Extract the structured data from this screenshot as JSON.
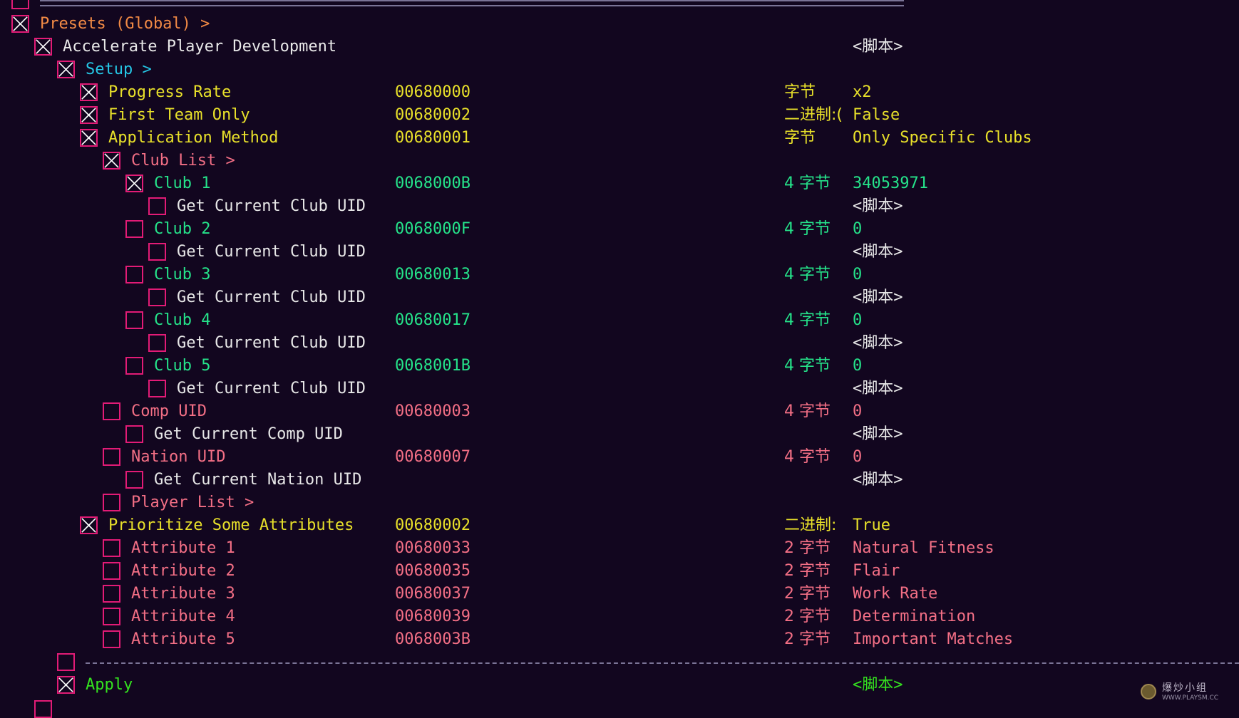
{
  "colors": {
    "background": "#12061f",
    "checkbox_border": "#e21b76",
    "checkbox_cross": "#ffffff",
    "orange": "#f28a45",
    "white": "#e8e8e8",
    "cyan": "#25c8e6",
    "yellow": "#e8e02a",
    "pink": "#f36f85",
    "green": "#25e38a",
    "apply_green": "#34e21f",
    "separator": "#7a7396"
  },
  "watermark": {
    "title": "爆炒小组",
    "url": "WWW.PLAYSM.CC"
  },
  "rows": [
    {
      "id": "presets-global",
      "level": 0,
      "checked": true,
      "color": "orange",
      "label": "Presets (Global) >",
      "address": "",
      "type": "",
      "value": ""
    },
    {
      "id": "accelerate-player-development",
      "level": 1,
      "checked": true,
      "color": "white",
      "label": "Accelerate Player Development",
      "address": "",
      "type": "",
      "value": "<脚本>"
    },
    {
      "id": "setup",
      "level": 2,
      "checked": true,
      "color": "cyan",
      "label": "Setup >",
      "address": "",
      "type": "",
      "value": ""
    },
    {
      "id": "progress-rate",
      "level": 3,
      "checked": true,
      "color": "yellow",
      "label": "Progress Rate",
      "address": "00680000",
      "type": "字节",
      "value": "x2"
    },
    {
      "id": "first-team-only",
      "level": 3,
      "checked": true,
      "color": "yellow",
      "label": "First Team Only",
      "address": "00680002",
      "type": "二进制:(",
      "value": "False"
    },
    {
      "id": "application-method",
      "level": 3,
      "checked": true,
      "color": "yellow",
      "label": "Application Method",
      "address": "00680001",
      "type": "字节",
      "value": "Only Specific Clubs"
    },
    {
      "id": "club-list",
      "level": 4,
      "checked": true,
      "color": "pink",
      "label": "Club List >",
      "address": "",
      "type": "",
      "value": ""
    },
    {
      "id": "club-1",
      "level": 5,
      "checked": true,
      "color": "green",
      "label": "Club 1",
      "address": "0068000B",
      "type": "4 字节",
      "value": "34053971"
    },
    {
      "id": "get-current-club-uid-1",
      "level": 6,
      "checked": false,
      "color": "white",
      "label": "Get Current Club UID",
      "address": "",
      "type": "",
      "value": "<脚本>"
    },
    {
      "id": "club-2",
      "level": 5,
      "checked": false,
      "color": "green",
      "label": "Club 2",
      "address": "0068000F",
      "type": "4 字节",
      "value": "0"
    },
    {
      "id": "get-current-club-uid-2",
      "level": 6,
      "checked": false,
      "color": "white",
      "label": "Get Current Club UID",
      "address": "",
      "type": "",
      "value": "<脚本>"
    },
    {
      "id": "club-3",
      "level": 5,
      "checked": false,
      "color": "green",
      "label": "Club 3",
      "address": "00680013",
      "type": "4 字节",
      "value": "0"
    },
    {
      "id": "get-current-club-uid-3",
      "level": 6,
      "checked": false,
      "color": "white",
      "label": "Get Current Club UID",
      "address": "",
      "type": "",
      "value": "<脚本>"
    },
    {
      "id": "club-4",
      "level": 5,
      "checked": false,
      "color": "green",
      "label": "Club 4",
      "address": "00680017",
      "type": "4 字节",
      "value": "0"
    },
    {
      "id": "get-current-club-uid-4",
      "level": 6,
      "checked": false,
      "color": "white",
      "label": "Get Current Club UID",
      "address": "",
      "type": "",
      "value": "<脚本>"
    },
    {
      "id": "club-5",
      "level": 5,
      "checked": false,
      "color": "green",
      "label": "Club 5",
      "address": "0068001B",
      "type": "4 字节",
      "value": "0"
    },
    {
      "id": "get-current-club-uid-5",
      "level": 6,
      "checked": false,
      "color": "white",
      "label": "Get Current Club UID",
      "address": "",
      "type": "",
      "value": "<脚本>"
    },
    {
      "id": "comp-uid",
      "level": 4,
      "checked": false,
      "color": "pink",
      "label": "Comp UID",
      "address": "00680003",
      "type": "4 字节",
      "value": "0"
    },
    {
      "id": "get-current-comp-uid",
      "level": 5,
      "checked": false,
      "color": "white",
      "label": "Get Current Comp UID",
      "address": "",
      "type": "",
      "value": "<脚本>"
    },
    {
      "id": "nation-uid",
      "level": 4,
      "checked": false,
      "color": "pink",
      "label": "Nation UID",
      "address": "00680007",
      "type": "4 字节",
      "value": "0"
    },
    {
      "id": "get-current-nation-uid",
      "level": 5,
      "checked": false,
      "color": "white",
      "label": "Get Current Nation UID",
      "address": "",
      "type": "",
      "value": "<脚本>"
    },
    {
      "id": "player-list",
      "level": 4,
      "checked": false,
      "color": "pink",
      "label": "Player List >",
      "address": "",
      "type": "",
      "value": ""
    },
    {
      "id": "prioritize-some-attributes",
      "level": 3,
      "checked": true,
      "color": "yellow",
      "label": "Prioritize Some Attributes",
      "address": "00680002",
      "type": "二进制:",
      "value": "True"
    },
    {
      "id": "attribute-1",
      "level": 4,
      "checked": false,
      "color": "pink",
      "label": "Attribute 1",
      "address": "00680033",
      "type": "2 字节",
      "value": "Natural Fitness"
    },
    {
      "id": "attribute-2",
      "level": 4,
      "checked": false,
      "color": "pink",
      "label": "Attribute 2",
      "address": "00680035",
      "type": "2 字节",
      "value": "Flair"
    },
    {
      "id": "attribute-3",
      "level": 4,
      "checked": false,
      "color": "pink",
      "label": "Attribute 3",
      "address": "00680037",
      "type": "2 字节",
      "value": "Work Rate"
    },
    {
      "id": "attribute-4",
      "level": 4,
      "checked": false,
      "color": "pink",
      "label": "Attribute 4",
      "address": "00680039",
      "type": "2 字节",
      "value": "Determination"
    },
    {
      "id": "attribute-5",
      "level": 4,
      "checked": false,
      "color": "pink",
      "label": "Attribute 5",
      "address": "0068003B",
      "type": "2 字节",
      "value": "Important Matches"
    },
    {
      "id": "separator",
      "level": 2,
      "checked": false,
      "color": "separator",
      "label": "",
      "address": "",
      "type": "",
      "value": ""
    },
    {
      "id": "apply",
      "level": 2,
      "checked": true,
      "color": "apply_green",
      "label": "Apply",
      "address": "",
      "type": "",
      "value": "<脚本>"
    }
  ]
}
